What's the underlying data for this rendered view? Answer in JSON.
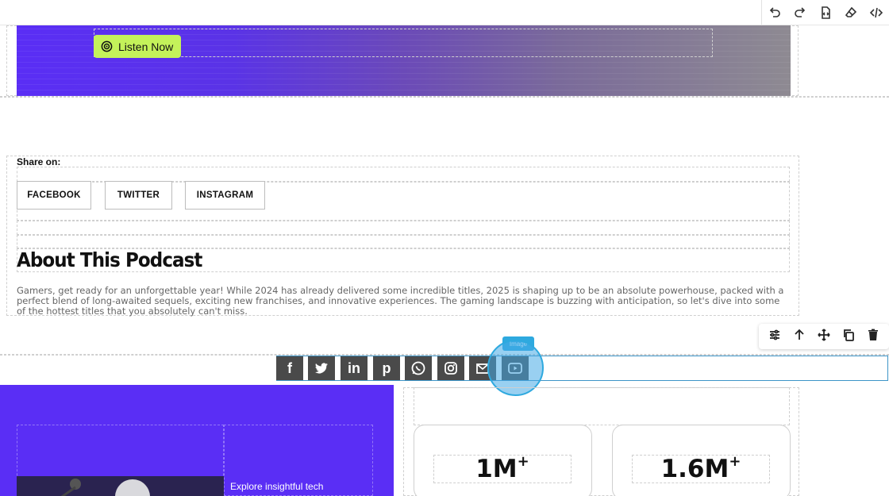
{
  "toolbar": {
    "icons": [
      "undo-icon",
      "redo-icon",
      "import-icon",
      "eraser-icon",
      "code-icon"
    ]
  },
  "hero": {
    "listen_label": "Listen Now"
  },
  "share": {
    "label": "Share on:",
    "buttons": [
      "FACEBOOK",
      "TWITTER",
      "INSTAGRAM"
    ]
  },
  "about": {
    "title": "About This Podcast",
    "text": "Gamers, get ready for an unforgettable year! While 2024 has already delivered some incredible titles, 2025 is shaping up to be an absolute powerhouse, packed with a perfect blend of long-awaited sequels, exciting new franchises, and innovative experiences. The gaming landscape is buzzing with anticipation, so let's dive into some of the hottest titles that you absolutely can't miss."
  },
  "element_toolbar": {
    "icons": [
      "settings-icon",
      "arrow-up-icon",
      "move-icon",
      "copy-icon",
      "trash-icon"
    ]
  },
  "social_icons": {
    "tag": "Image",
    "items": [
      "f",
      "t",
      "in",
      "p",
      "w",
      "ig",
      "m",
      "yt"
    ]
  },
  "bottom": {
    "explore_text": "Explore insightful tech",
    "stats": [
      {
        "value": "1M",
        "suffix": "+"
      },
      {
        "value": "1.6M",
        "suffix": "+"
      }
    ]
  },
  "colors": {
    "purple": "#5a2ef5",
    "listen_green": "#c4f25a",
    "selection_blue": "#2ea9df"
  }
}
